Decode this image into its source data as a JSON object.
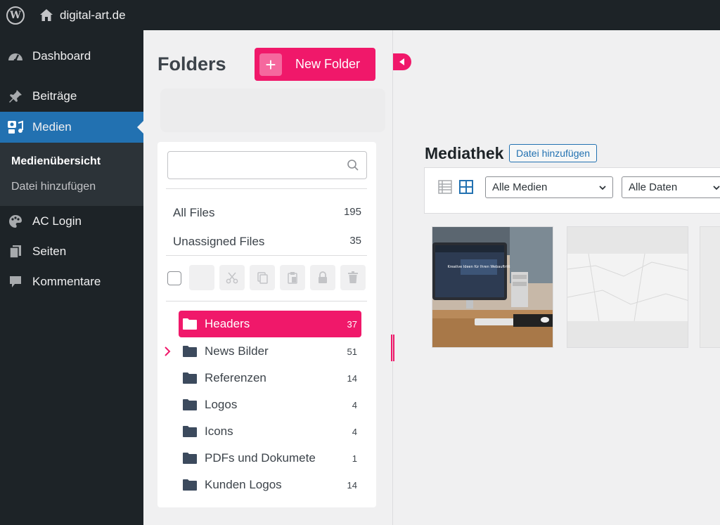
{
  "adminbar": {
    "site_name": "digital-art.de"
  },
  "sidebar": {
    "items": [
      {
        "label": "Dashboard",
        "icon": "dashboard-icon"
      },
      {
        "label": "Beiträge",
        "icon": "pin-icon"
      },
      {
        "label": "Medien",
        "icon": "media-icon"
      },
      {
        "label": "AC Login",
        "icon": "palette-icon"
      },
      {
        "label": "Seiten",
        "icon": "pages-icon"
      },
      {
        "label": "Kommentare",
        "icon": "comment-icon"
      }
    ],
    "submenu": [
      "Medienübersicht",
      "Datei hinzufügen"
    ]
  },
  "folders": {
    "title": "Folders",
    "new_folder_label": "New Folder",
    "search_placeholder": "",
    "all_files": {
      "label": "All Files",
      "count": "195"
    },
    "unassigned": {
      "label": "Unassigned Files",
      "count": "35"
    },
    "tree": [
      {
        "label": "Headers",
        "count": "37"
      },
      {
        "label": "News Bilder",
        "count": "51"
      },
      {
        "label": "Referenzen",
        "count": "14"
      },
      {
        "label": "Logos",
        "count": "4"
      },
      {
        "label": "Icons",
        "count": "4"
      },
      {
        "label": "PDFs und Dokumete",
        "count": "1"
      },
      {
        "label": "Kunden Logos",
        "count": "14"
      }
    ]
  },
  "media": {
    "title": "Mediathek",
    "add_label": "Datei hinzufügen",
    "filter_type": "Alle Medien",
    "filter_date": "Alle Daten",
    "thumb_screen_text": "Kreative Ideen für Ihren Webauftritt"
  },
  "colors": {
    "accent": "#f0186a",
    "wp_blue": "#2271b1",
    "sidebar_bg": "#1d2327"
  }
}
